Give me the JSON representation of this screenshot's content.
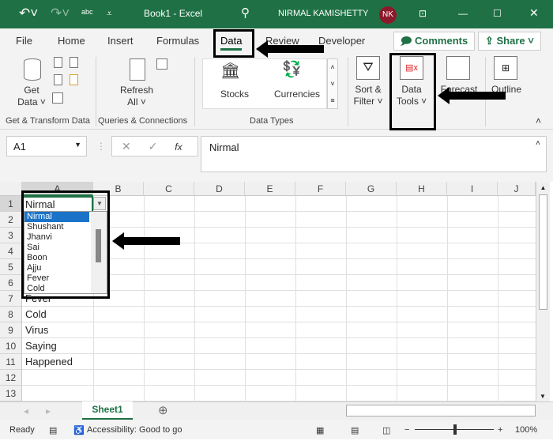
{
  "titlebar": {
    "title": "Book1 - Excel",
    "user": "NIRMAL KAMISHETTY",
    "initials": "NK",
    "spell": "abc"
  },
  "tabs": [
    "File",
    "Home",
    "Insert",
    "Formulas",
    "Data",
    "Review",
    "Developer"
  ],
  "active_tab": "Data",
  "buttons": {
    "comments": "Comments",
    "share": "Share"
  },
  "ribbon": {
    "get_data": [
      "Get",
      "Data ˅"
    ],
    "refresh": [
      "Refresh",
      "All ˅"
    ],
    "stocks": "Stocks",
    "currencies": "Currencies",
    "sort": [
      "Sort &",
      "Filter ˅"
    ],
    "data_tools": [
      "Data",
      "Tools ˅"
    ],
    "forecast": "Forecast",
    "outline": "Outline",
    "groups": [
      "Get & Transform Data",
      "Queries & Connections",
      "Data Types"
    ]
  },
  "formula_bar": {
    "name_box": "A1",
    "fx": "fx",
    "content": "Nirmal"
  },
  "columns": [
    "A",
    "B",
    "C",
    "D",
    "E",
    "F",
    "G",
    "H",
    "I",
    "J"
  ],
  "rows": [
    "1",
    "2",
    "3",
    "4",
    "5",
    "6",
    "7",
    "8",
    "9",
    "10",
    "11",
    "12",
    "13"
  ],
  "cells": {
    "A1": "Nirmal",
    "A7": "Fever",
    "A8": "Cold",
    "A9": "Virus",
    "A10": "Saying",
    "A11": "Happened"
  },
  "dropdown": {
    "options": [
      "Nirmal",
      "Shushant",
      "Jhanvi",
      "Sai",
      "Boon",
      "Ajju",
      "Fever",
      "Cold"
    ],
    "selected": "Nirmal"
  },
  "sheet_tab": "Sheet1",
  "status": {
    "ready": "Ready",
    "accessibility": "Accessibility: Good to go",
    "zoom": "100%"
  },
  "colors": {
    "excel_green": "#1f7145",
    "selection_blue": "#1a73c8"
  }
}
